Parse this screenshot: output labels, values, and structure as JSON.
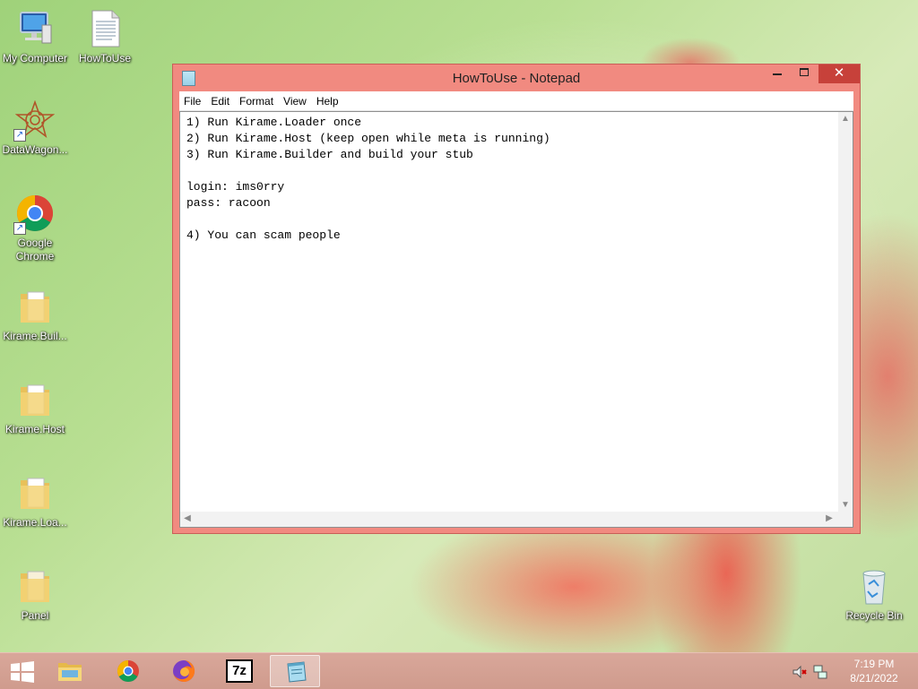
{
  "desktop": {
    "icons": [
      {
        "label": "My Computer"
      },
      {
        "label": "HowToUse"
      },
      {
        "label": "DataWagon..."
      },
      {
        "label": "Google Chrome"
      },
      {
        "label": "Kirame.Buil..."
      },
      {
        "label": "Kirame.Host"
      },
      {
        "label": "Kirame.Loa..."
      },
      {
        "label": "Panel"
      },
      {
        "label": "Recycle Bin"
      }
    ]
  },
  "window": {
    "title": "HowToUse - Notepad",
    "close_glyph": "✕",
    "menu": [
      "File",
      "Edit",
      "Format",
      "View",
      "Help"
    ],
    "content": "1) Run Kirame.Loader once\n2) Run Kirame.Host (keep open while meta is running)\n3) Run Kirame.Builder and build your stub\n\nlogin: ims0rry\npass: racoon\n\n4) You can scam people"
  },
  "taskbar": {
    "pinned": [
      "file-explorer-icon",
      "chrome-icon",
      "firefox-icon",
      "7zip-icon",
      "notepad-icon"
    ],
    "sevenzip_label": "7z",
    "time": "7:19 PM",
    "date": "8/21/2022"
  },
  "colors": {
    "window_frame": "#f18a80",
    "close_button": "#c7413a",
    "taskbar": "#d3a093"
  }
}
